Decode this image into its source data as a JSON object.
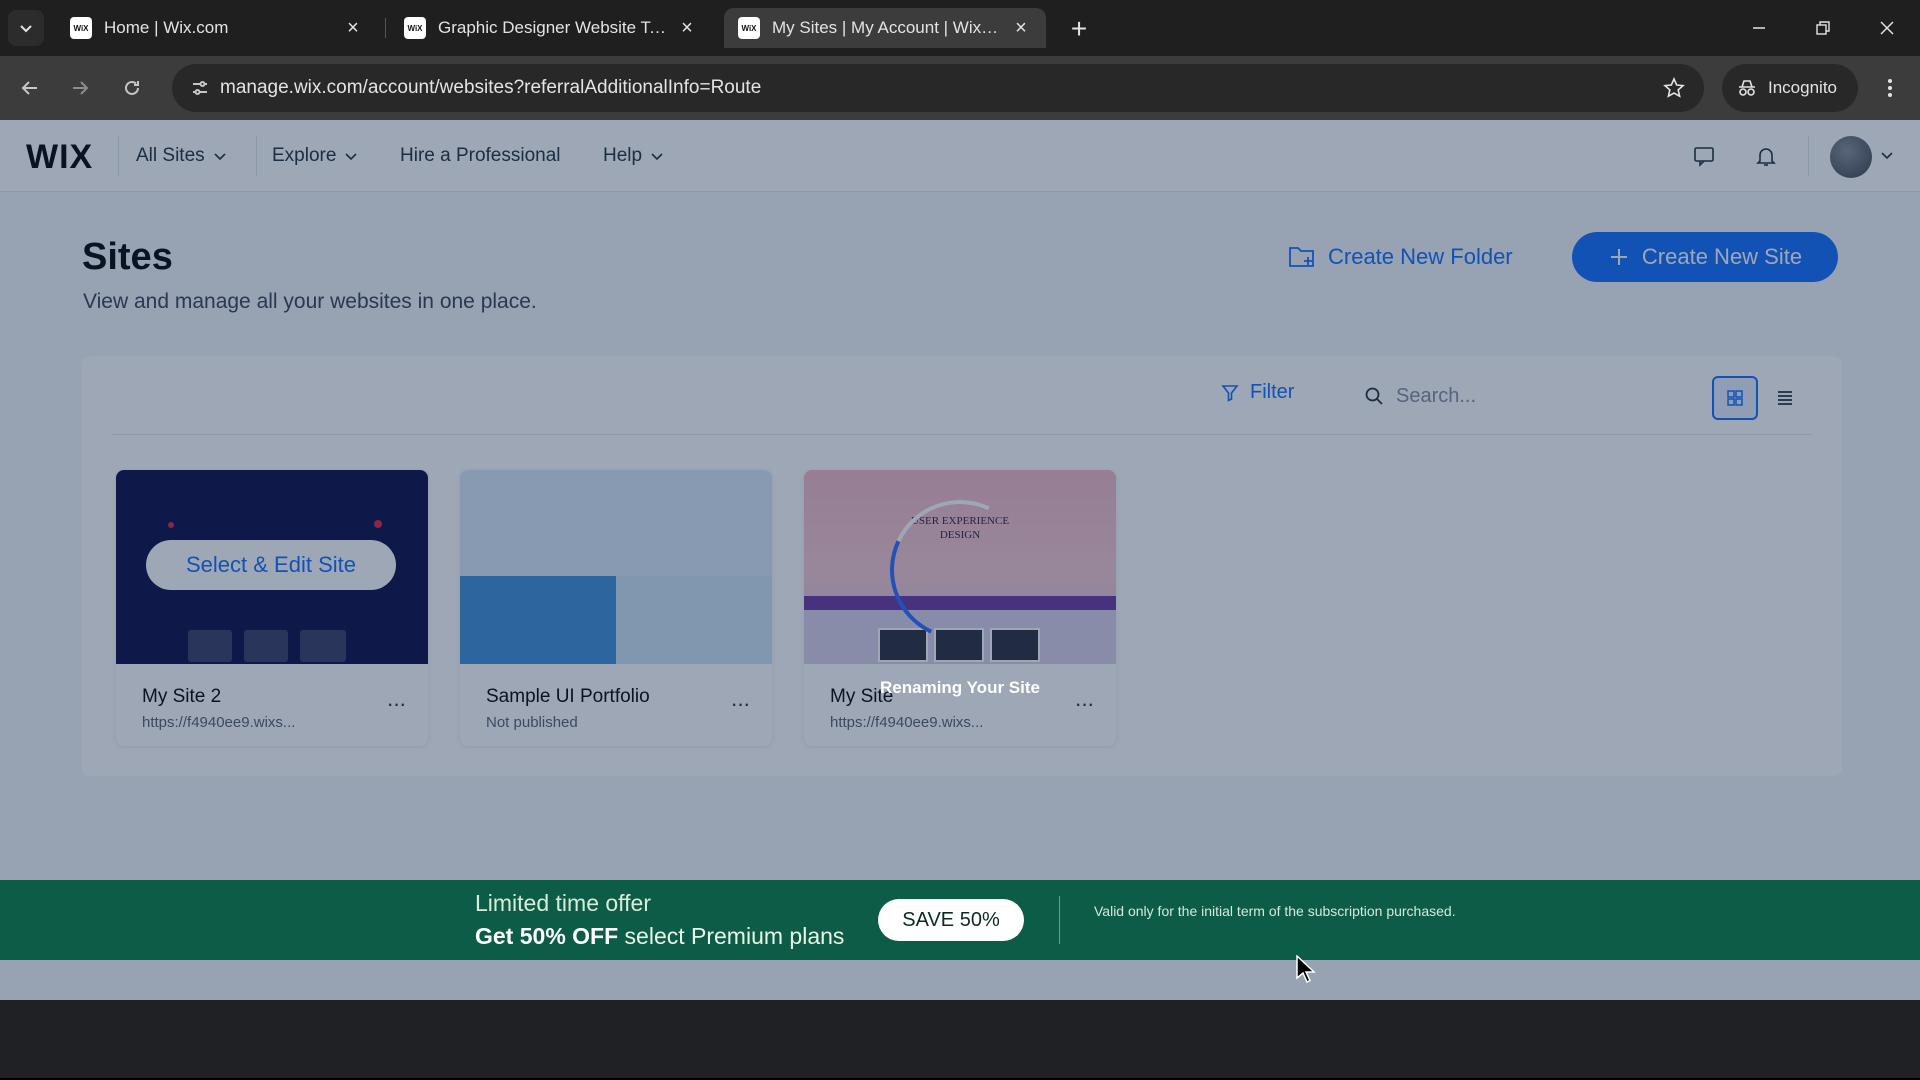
{
  "browser": {
    "tabs": [
      {
        "title": "Home | Wix.com",
        "favicon": "WiX",
        "active": false
      },
      {
        "title": "Graphic Designer Website Temp",
        "favicon": "WiX",
        "active": false
      },
      {
        "title": "My Sites | My Account | Wix.cor",
        "favicon": "WiX",
        "active": true
      }
    ],
    "url": "manage.wix.com/account/websites?referralAdditionalInfo=Route",
    "incognito_label": "Incognito"
  },
  "topnav": {
    "logo": "WIX",
    "items": [
      "All Sites",
      "Explore",
      "Hire a Professional",
      "Help"
    ]
  },
  "header": {
    "title": "Sites",
    "subtitle": "View and manage all your websites in one place.",
    "create_folder_label": "Create New Folder",
    "create_site_label": "Create New Site"
  },
  "toolbar": {
    "filter_label": "Filter",
    "search_placeholder": "Search..."
  },
  "sites": [
    {
      "name": "My Site 2",
      "status": "https://f4940ee9.wixs...",
      "hover_action": "Select & Edit Site"
    },
    {
      "name": "Sample UI Portfolio",
      "status": "Not published"
    },
    {
      "name": "My Site",
      "status": "https://f4940ee9.wixs...",
      "overlay_text": "Renaming Your Site",
      "thumb_headline": "USER EXPERIENCE DESIGN"
    }
  ],
  "banner": {
    "line1": "Limited time offer",
    "line2_bold": "Get 50% OFF",
    "line2_rest": " select Premium plans",
    "cta": "SAVE 50%",
    "note": "Valid only for the initial term of the subscription purchased."
  },
  "colors": {
    "accent": "#116dff",
    "banner": "#0d5c48",
    "page_bg": "#f4f6fa"
  }
}
